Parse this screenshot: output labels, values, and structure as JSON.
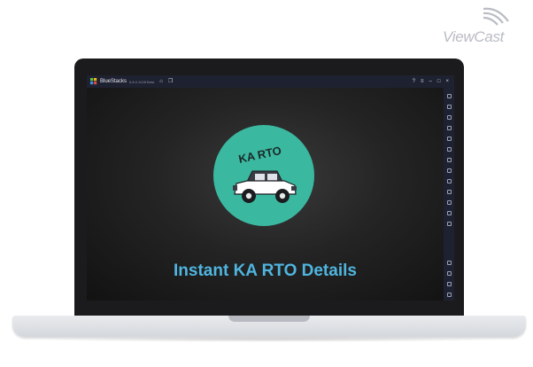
{
  "watermark": {
    "text": "ViewCast"
  },
  "window": {
    "app_name": "BlueStacks",
    "version": "5.8.0.1028 Beta",
    "controls": [
      "help-icon",
      "menu-icon",
      "minimize-icon",
      "maximize-icon",
      "close-icon"
    ]
  },
  "app": {
    "logo_text": "KA RTO",
    "title": "Instant KA RTO Details"
  },
  "sidebar": {
    "icons": [
      "fullscreen-icon",
      "volume-up-icon",
      "volume-down-icon",
      "media-icon",
      "screenshot-icon",
      "rotate-icon",
      "keyboard-icon",
      "gamepad-icon",
      "location-icon",
      "folder-icon",
      "multi-instance-icon",
      "layers-icon",
      "eco-icon",
      "settings-icon",
      "back-icon",
      "home-icon",
      "recent-apps-icon"
    ]
  },
  "colors": {
    "circle": "#3bb9a0",
    "title": "#4fb5df",
    "titlebar": "#1e2130"
  }
}
